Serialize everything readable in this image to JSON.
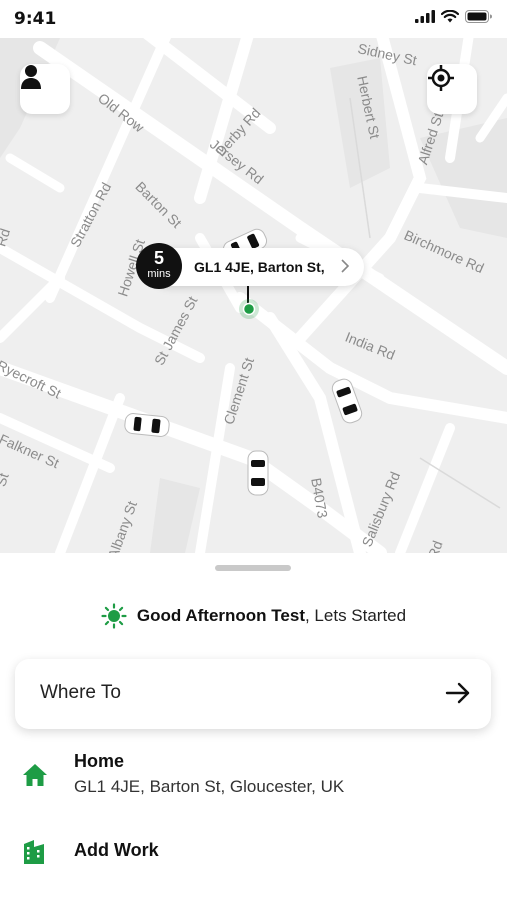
{
  "status_bar": {
    "time": "9:41"
  },
  "map": {
    "streets": [
      "Sidney St",
      "Old Row",
      "Derby Rd",
      "Herbert St",
      "Alfred St",
      "Jersey Rd",
      "Barton St",
      "Stratton Rd",
      "Birchmore Rd",
      "Howell St",
      "St James St",
      "India Rd",
      "Ryecroft St",
      "Clement St",
      "Falkner St",
      "B4073",
      "Salisbury Rd",
      "Albany St",
      "Rd",
      "St",
      "Rd"
    ]
  },
  "eta": {
    "value": "5",
    "unit": "mins",
    "address": "GL1 4JE, Barton St,"
  },
  "greeting": {
    "bold": "Good Afternoon Test",
    "rest": ", Lets Started"
  },
  "search": {
    "label": "Where To"
  },
  "places": [
    {
      "title": "Home",
      "subtitle": "GL1 4JE, Barton St, Gloucester, UK",
      "icon": "home-icon"
    },
    {
      "title": "Add Work",
      "icon": "work-building-icon"
    }
  ],
  "colors": {
    "accent_green": "#1e9c45",
    "dark": "#111111",
    "map_bg": "#efefef"
  }
}
